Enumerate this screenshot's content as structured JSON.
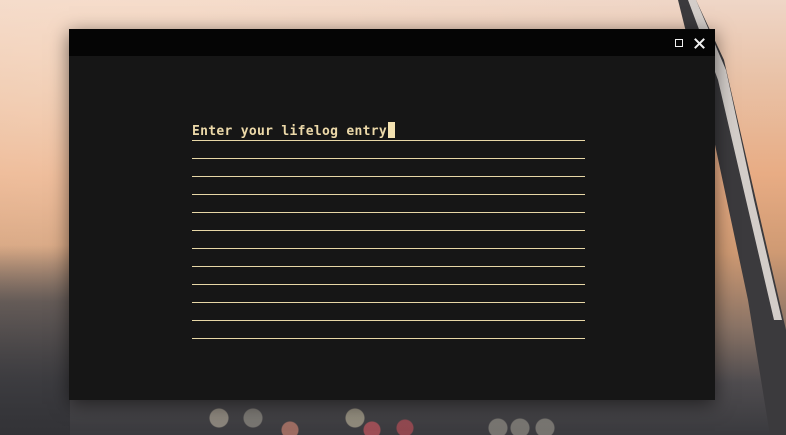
{
  "window": {
    "title": "",
    "controls": {
      "maximize_icon": "maximize-icon",
      "close_icon": "close-icon"
    }
  },
  "entry": {
    "prompt": "Enter your lifelog entry",
    "line_count": 12,
    "line_color": "#e7d7a6",
    "text_color": "#ecd9a9"
  },
  "colors": {
    "window_bg": "#161616",
    "titlebar_bg": "#050505"
  }
}
